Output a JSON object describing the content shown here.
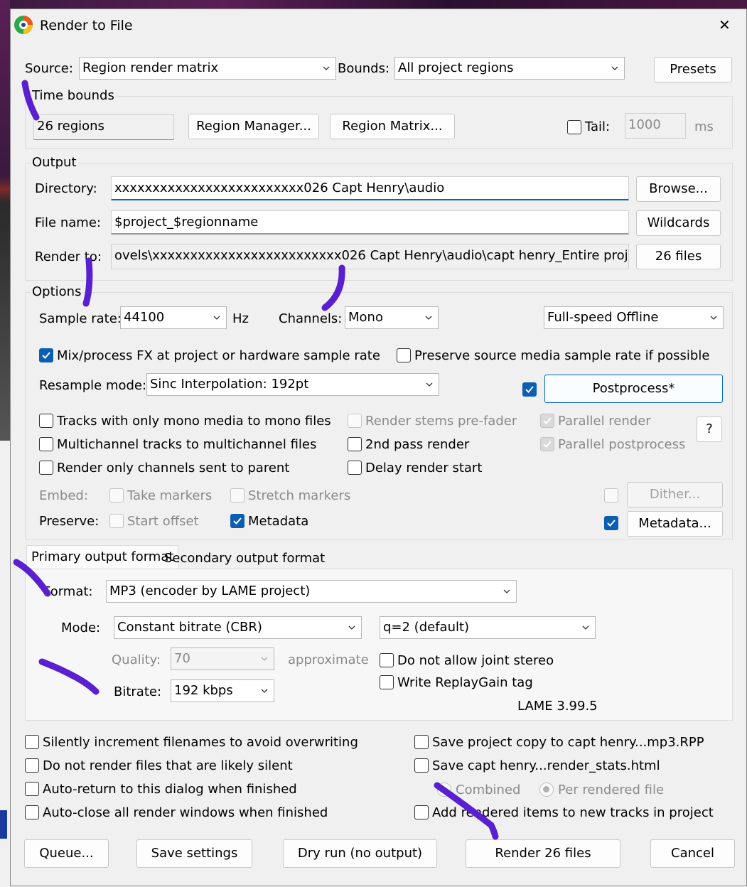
{
  "window": {
    "title": "Render to File",
    "close_glyph": "✕"
  },
  "source": {
    "label": "Source:",
    "value": "Region render matrix"
  },
  "bounds": {
    "label": "Bounds:",
    "value": "All project regions"
  },
  "presets_button": "Presets",
  "time_bounds": {
    "title": "Time bounds",
    "regions_value": "26 regions",
    "region_manager_button": "Region Manager...",
    "region_matrix_button": "Region Matrix...",
    "tail_label": "Tail:",
    "tail_checked": false,
    "tail_value": "1000",
    "tail_unit": "ms"
  },
  "output": {
    "title": "Output",
    "directory_label": "Directory:",
    "directory_value": "xxxxxxxxxxxxxxxxxxxxxxxxx026 Capt Henry\\audio",
    "browse_button": "Browse...",
    "filename_label": "File name:",
    "filename_value": "$project_$regionname",
    "wildcards_button": "Wildcards",
    "render_to_label": "Render to:",
    "render_to_value": "ovels\\xxxxxxxxxxxxxxxxxxxxxxxxx026 Capt Henry\\audio\\capt henry_Entire project.mp3",
    "files_button": "26 files"
  },
  "options": {
    "title": "Options",
    "sample_rate_label": "Sample rate:",
    "sample_rate_value": "44100",
    "sample_rate_unit": "Hz",
    "channels_label": "Channels:",
    "channels_value": "Mono",
    "speed_value": "Full-speed Offline",
    "mix_fx_label": "Mix/process FX at project or hardware sample rate",
    "preserve_source_label": "Preserve source media sample rate if possible",
    "resample_label": "Resample mode:",
    "resample_value": "Sinc Interpolation: 192pt",
    "postprocess_button": "Postprocess*",
    "tracks_mono_label": "Tracks with only mono media to mono files",
    "multichannel_label": "Multichannel tracks to multichannel files",
    "render_parent_label": "Render only channels sent to parent",
    "stems_prefader_label": "Render stems pre-fader",
    "second_pass_label": "2nd pass render",
    "delay_start_label": "Delay render start",
    "parallel_render_label": "Parallel render",
    "parallel_post_label": "Parallel postprocess",
    "help_button": "?",
    "embed_label": "Embed:",
    "take_markers_label": "Take markers",
    "stretch_markers_label": "Stretch markers",
    "dither_button": "Dither...",
    "preserve_label": "Preserve:",
    "start_offset_label": "Start offset",
    "metadata_label": "Metadata",
    "metadata_button": "Metadata..."
  },
  "format_tabs": {
    "primary": "Primary output format",
    "secondary": "Secondary output format"
  },
  "format": {
    "format_label": "Format:",
    "format_value": "MP3 (encoder by LAME project)",
    "mode_label": "Mode:",
    "mode_value": "Constant bitrate  (CBR)",
    "q_value": "q=2 (default)",
    "quality_label": "Quality:",
    "quality_value": "70",
    "quality_note": "approximate",
    "bitrate_label": "Bitrate:",
    "bitrate_value": "192 kbps",
    "joint_stereo_label": "Do not allow joint stereo",
    "replaygain_label": "Write ReplayGain tag",
    "lame_version": "LAME 3.99.5"
  },
  "bottom": {
    "silently_increment_label": "Silently increment filenames to avoid overwriting",
    "no_silent_label": "Do not render files that are likely silent",
    "auto_return_label": "Auto-return to this dialog when finished",
    "auto_close_label": "Auto-close all render windows when finished",
    "save_copy_label": "Save project copy to capt henry...mp3.RPP",
    "save_stats_label": "Save capt henry...render_stats.html",
    "combined_label": "Combined",
    "per_file_label": "Per rendered file",
    "add_items_label": "Add rendered items to new tracks in project"
  },
  "buttons": {
    "queue": "Queue...",
    "save_settings": "Save settings",
    "dry_run": "Dry run (no output)",
    "render": "Render 26 files",
    "cancel": "Cancel"
  },
  "colors": {
    "accent": "#0a5fb4",
    "annotation": "#5a1fd0"
  }
}
